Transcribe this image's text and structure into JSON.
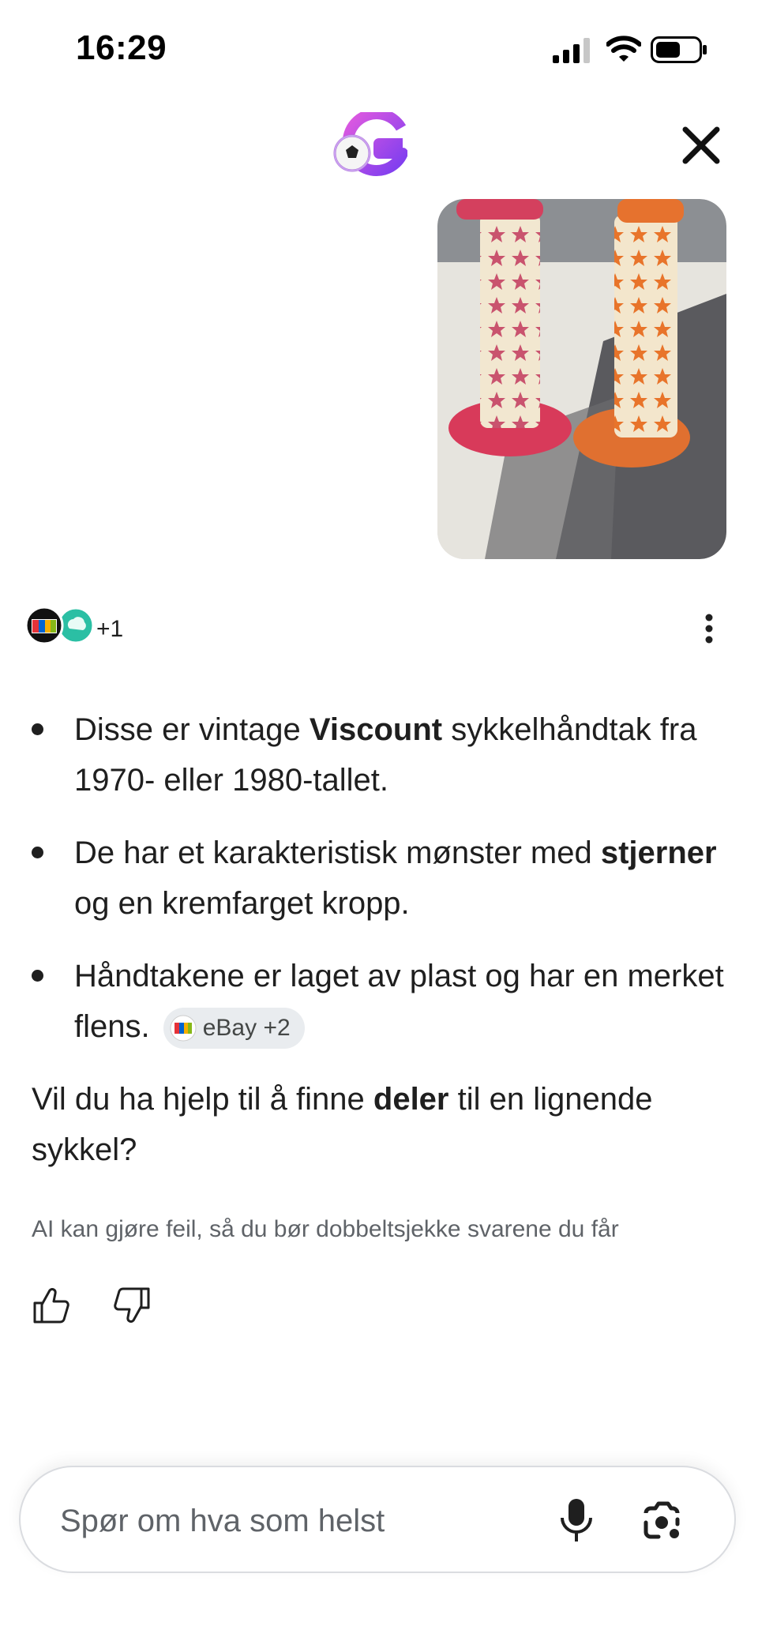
{
  "status_bar": {
    "time": "16:29",
    "icons": [
      "cellular-signal-icon",
      "wifi-icon",
      "battery-icon"
    ]
  },
  "header": {
    "logo_icon": "google-logo-icon",
    "close_icon": "close-icon"
  },
  "image": {
    "description_icon": "photo-bike-grips"
  },
  "sources": {
    "count_label": "+1"
  },
  "answer": {
    "bullets": [
      {
        "pre": "Disse er vintage ",
        "bold": "Viscount",
        "post": " sykkelhåndtak fra 1970- eller 1980-tallet."
      },
      {
        "pre": "De har et karakteristisk mønster med ",
        "bold": "stjerner",
        "post": " og en kremfarget kropp."
      },
      {
        "pre": "Håndtakene er laget av plast og har en merket flens.",
        "bold": "",
        "post": "",
        "chip": "eBay +2"
      }
    ],
    "question": {
      "pre": "Vil du ha hjelp til å finne ",
      "bold": "deler",
      "post": " til en lignende sykkel?"
    }
  },
  "disclaimer": "AI kan gjøre feil, så du bør dobbeltsjekke svarene du får",
  "input": {
    "placeholder": "Spør om hva som helst"
  },
  "colors": {
    "text": "#1f1f1f",
    "muted": "#5f6368",
    "chip_bg": "#e9ecef",
    "border": "#dadce0"
  }
}
